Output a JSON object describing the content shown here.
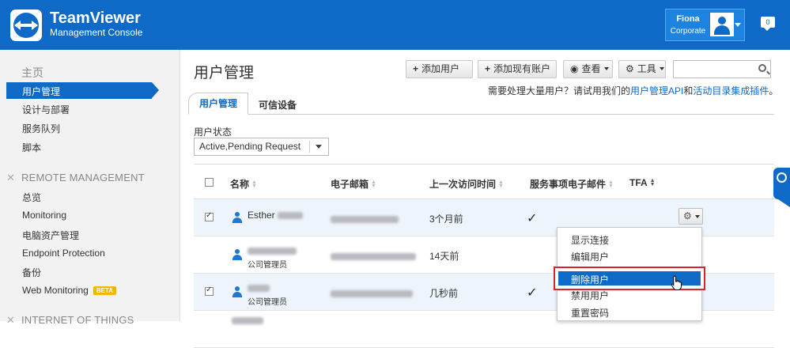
{
  "header": {
    "brand_title": "TeamViewer",
    "brand_subtitle": "Management Console",
    "user_name": "Fiona",
    "user_org": "Corporate",
    "notifications": "0"
  },
  "sidebar": {
    "home": "主页",
    "items_home": [
      "用户管理",
      "设计与部署",
      "服务队列",
      "脚本"
    ],
    "remote_section": "REMOTE MANAGEMENT",
    "items_remote": [
      "总览",
      "Monitoring",
      "电脑资产管理",
      "Endpoint Protection",
      "备份",
      "Web Monitoring"
    ],
    "beta_badge": "BETA",
    "iot_section": "INTERNET OF THINGS"
  },
  "main": {
    "title": "用户管理",
    "buttons": {
      "add_user": "添加用户",
      "add_existing": "添加现有账户",
      "view": "查看",
      "tools": "工具"
    },
    "search_placeholder": "",
    "hint_text": "需要处理大量用户？请试用我们的",
    "hint_link1": "用户管理API",
    "hint_and": "和",
    "hint_link2": "活动目录集成插件",
    "hint_end": "。",
    "tabs": [
      "用户管理",
      "可信设备"
    ],
    "status_label": "用户状态",
    "status_value": "Active,Pending Request"
  },
  "table": {
    "headers": [
      "名称",
      "电子邮箱",
      "上一次访问时间",
      "服务事项电子邮件",
      "TFA"
    ],
    "rows": [
      {
        "name": "Esther",
        "role": "",
        "last_access": "3个月前",
        "service_email": "✓",
        "checked": true
      },
      {
        "name": "",
        "role": "公司管理员",
        "last_access": "14天前",
        "service_email": "",
        "checked": false
      },
      {
        "name": "",
        "role": "公司管理员",
        "last_access": "几秒前",
        "service_email": "✓",
        "checked": true
      },
      {
        "name": "",
        "role": "",
        "last_access": "",
        "service_email": "",
        "checked": false
      }
    ]
  },
  "context_menu": {
    "items": [
      "显示连接",
      "编辑用户",
      "删除用户",
      "禁用用户",
      "重置密码"
    ],
    "highlighted": "删除用户"
  },
  "colors": {
    "brand_blue": "#0e6ac6",
    "highlight_red": "#d9232e"
  }
}
